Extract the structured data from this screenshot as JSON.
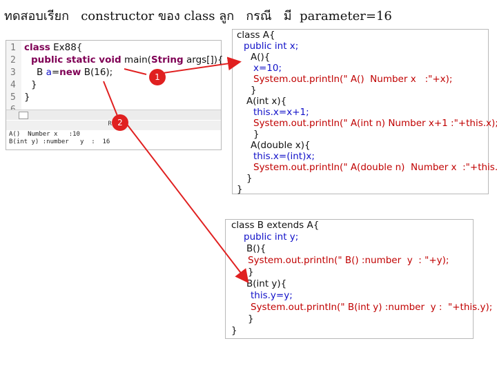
{
  "title": "ทดสอบเรียก   constructor ของ class ลูก   กรณี   มี  parameter=16",
  "editor": {
    "line_numbers": [
      "1",
      "2",
      "3",
      "4",
      "5",
      "6"
    ],
    "line1": {
      "kw": "class",
      "rest": " Ex88{"
    },
    "line2": {
      "kw": "public static void",
      "rest": " main(",
      "type": "String",
      "rest2": " args[]){"
    },
    "line3": {
      "rest": "B ",
      "var": "a",
      "rest2": "=",
      "kw": "new",
      "rest3": " B(16);"
    },
    "line4": "}",
    "line5": "}",
    "console_tab": "Run",
    "console_lines": [
      "A()  Number x   :10",
      "B(int y) :number   y  :  16"
    ]
  },
  "classA": {
    "lines": [
      [
        "class A{"
      ],
      [
        "public int x;"
      ],
      [
        "A(){"
      ],
      [
        "x=10;"
      ],
      [
        "System.out.println(\" A()  Number x   :\"+x);"
      ],
      [
        "}"
      ],
      [
        "A(int x){"
      ],
      [
        "this.x=x+1;"
      ],
      [
        "System.out.println(\" A(int n) Number x+1 :\"+this.x);"
      ],
      [
        "}"
      ],
      [
        "A(double x){"
      ],
      [
        "this.x=(int)x;"
      ],
      [
        "System.out.println(\" A(double n)  Number x  :\"+this.x);"
      ],
      [
        "}"
      ],
      [
        "}"
      ]
    ]
  },
  "classB": {
    "lines": [
      [
        "class B extends A{"
      ],
      [
        "public int y;"
      ],
      [
        "B(){"
      ],
      [
        "System.out.println(\" B() :number  y  : \"+y);"
      ],
      [
        "}"
      ],
      [
        "B(int y){"
      ],
      [
        "this.y=y;"
      ],
      [
        "System.out.println(\" B(int y) :number  y :  \"+this.y);"
      ],
      [
        "}"
      ],
      [
        "}"
      ]
    ]
  },
  "markers": [
    "1",
    "2"
  ],
  "colors": {
    "arrow": "#e02020",
    "keyword": "#7f0055",
    "field": "#1010c8",
    "call": "#c00000"
  }
}
